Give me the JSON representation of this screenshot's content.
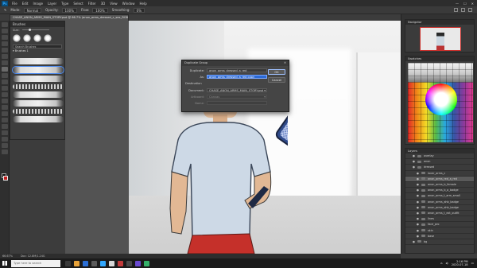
{
  "app": {
    "logo": "Ps"
  },
  "menubar": {
    "items": [
      "File",
      "Edit",
      "Image",
      "Layer",
      "Type",
      "Select",
      "Filter",
      "3D",
      "View",
      "Window",
      "Help"
    ],
    "window_controls": [
      "—",
      "☐",
      "✕"
    ]
  },
  "options": {
    "mode_label": "Mode:",
    "mode_value": "Normal",
    "opacity_label": "Opacity:",
    "opacity_value": "100%",
    "flow_label": "Flow:",
    "flow_value": "100%",
    "smoothing_label": "Smoothing:",
    "smoothing_value": "0%"
  },
  "document": {
    "tab_title": "CHASE_ANON_ARMS_MAIN_STORY.psd @ 66.7% (anon_arms_dressed_c_sex_RGB/8) *"
  },
  "brush_panel": {
    "title": "Brushes",
    "size_label": "Size:",
    "search_placeholder": "Search Brushes",
    "folder_label": "Brushes 1"
  },
  "dialog": {
    "title": "Duplicate Group",
    "close": "✕",
    "duplicate_label": "Duplicate:",
    "duplicate_value": "anon_arms_dressed_a_red",
    "as_label": "As:",
    "as_value": "anon_arms_dressed_a_red copy",
    "destination_label": "Destination",
    "document_label": "Document:",
    "document_value": "CHASE_ANON_ARMS_MAIN_STORY.psd",
    "artboard_label": "Artboard:",
    "artboard_value": "Canvas",
    "name_label": "Name:",
    "ok": "OK",
    "cancel": "Cancel"
  },
  "right": {
    "navigator_title": "Navigator",
    "swatches_title": "Swatches",
    "layers_title": "Layers",
    "layers": [
      {
        "name": "overlay",
        "level": 1,
        "selected": false
      },
      {
        "name": "anon",
        "level": 1,
        "selected": false
      },
      {
        "name": "dressed",
        "level": 1,
        "selected": false
      },
      {
        "name": "lover_arms_c",
        "level": 2,
        "selected": false
      },
      {
        "name": "anon_arms_red_a_red",
        "level": 2,
        "selected": true
      },
      {
        "name": "anon_arms_b_female",
        "level": 2,
        "selected": false
      },
      {
        "name": "anon_arms_b_a_badge",
        "level": 2,
        "selected": false
      },
      {
        "name": "anon_arms_t_arm_small",
        "level": 2,
        "selected": false
      },
      {
        "name": "anon_arms_ahb_badge",
        "level": 2,
        "selected": false
      },
      {
        "name": "anon_arms_ahb_badge",
        "level": 2,
        "selected": false
      },
      {
        "name": "anon_arms_t_ext_outfit",
        "level": 2,
        "selected": false
      },
      {
        "name": "lines",
        "level": 2,
        "selected": false
      },
      {
        "name": "face_pro",
        "level": 2,
        "selected": false
      },
      {
        "name": "skin",
        "level": 2,
        "selected": false
      },
      {
        "name": "base",
        "level": 2,
        "selected": false
      },
      {
        "name": "bg",
        "level": 1,
        "selected": false
      }
    ]
  },
  "statusbar": {
    "zoom": "66.67%",
    "doc_info": "Doc: 12.8M/1.24G"
  },
  "taskbar": {
    "search_placeholder": "Type here to search",
    "time": "2:16 PM",
    "date": "2020-07-18"
  }
}
